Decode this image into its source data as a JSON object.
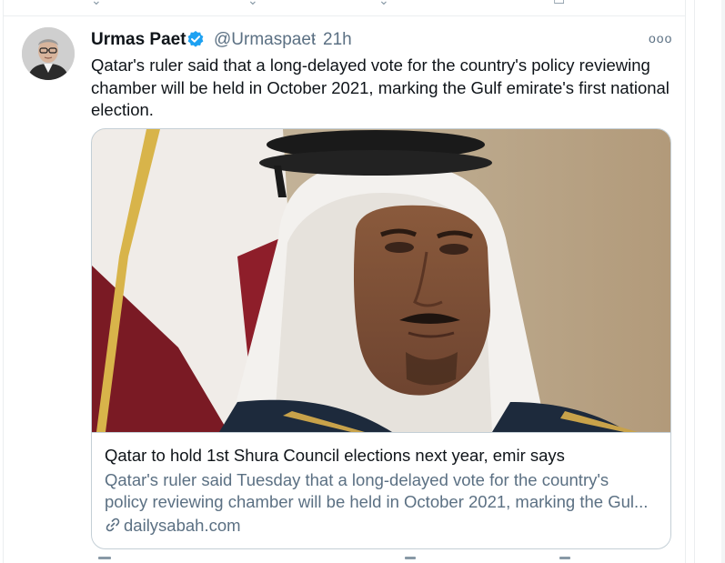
{
  "tweet": {
    "author_name": "Urmas Paet",
    "handle": "@Urmaspaet",
    "separator": "·",
    "time": "21h",
    "more_label": "ooo",
    "text": "Qatar's ruler said that a long-delayed vote for the country's policy reviewing chamber will be held in October 2021, marking the Gulf emirate's first national election.",
    "card": {
      "title": "Qatar to hold 1st Shura Council elections next year, emir says",
      "description_line1": "Qatar's ruler said Tuesday that a long-delayed vote for the country's",
      "description_line2": "policy reviewing chamber will be held in October 2021, marking the Gul...",
      "domain": "dailysabah.com"
    }
  },
  "colors": {
    "text_primary": "#0f1419",
    "text_secondary": "#5b7083",
    "verified_blue": "#1da1f2",
    "border": "#c4cfd6"
  },
  "icons": [
    "verified-badge-icon",
    "more-options-icon",
    "link-icon"
  ]
}
